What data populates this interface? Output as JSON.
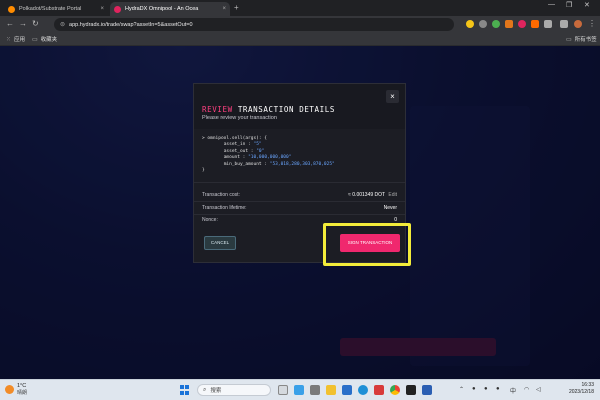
{
  "browser": {
    "tabs": [
      {
        "title": "Polkadot/Substrate Portal",
        "favicon_color": "#ff8c00",
        "active": false
      },
      {
        "title": "HydraDX Omnipool - An Ocea",
        "favicon_color": "#e0245e",
        "active": true
      }
    ],
    "new_tab_label": "+",
    "url": "app.hydradx.io/trade/swap?assetIn=5&assetOut=0",
    "bookmarks": [
      {
        "label": "应用",
        "icon": "apps-grid-icon"
      },
      {
        "label": "收藏夹",
        "icon": "folder-icon"
      }
    ],
    "all_bookmarks_label": "所有书签"
  },
  "modal": {
    "title_accent": "REVIEW",
    "title_rest": " TRANSACTION DETAILS",
    "subtitle": "Please review your transaction",
    "close_icon": "×",
    "code": {
      "header": "> omnipool.sell(args): {",
      "lines": [
        {
          "key": "asset_in : ",
          "value": "\"5\""
        },
        {
          "key": "asset_out : ",
          "value": "\"0\""
        },
        {
          "key": "amount : ",
          "value": "\"10,000,000,000\""
        },
        {
          "key": "min_buy_amount : ",
          "value": "\"53,018,280,303,870,025\""
        }
      ],
      "footer": "}"
    },
    "details": [
      {
        "label": "Transaction cost:",
        "value": "≈ 0.001349 DOT",
        "extra": "Edit"
      },
      {
        "label": "Transaction lifetime:",
        "value": "Never",
        "extra": ""
      },
      {
        "label": "Nonce:",
        "value": "0",
        "extra": ""
      }
    ],
    "cancel_label": "CANCEL",
    "sign_label": "SIGN TRANSACTION",
    "sign_color": "#f0286e",
    "highlight_color": "#f3ec3a"
  },
  "taskbar": {
    "temperature": "1°C",
    "weather_text": "晴朗",
    "search_placeholder": "搜索",
    "time": "16:33",
    "date": "2023/12/18",
    "ime": "中",
    "tray_icons": [
      "chevron-up-icon",
      "wifi-icon",
      "volume-icon"
    ]
  }
}
